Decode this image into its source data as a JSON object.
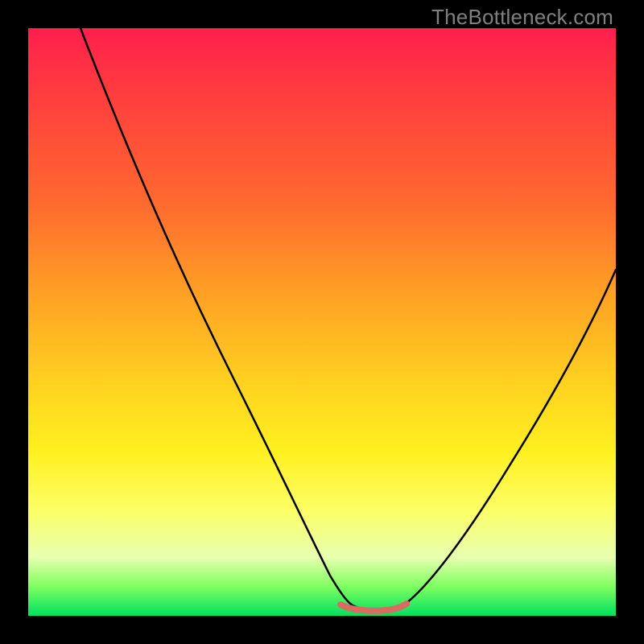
{
  "watermark": "TheBottleneck.com",
  "colors": {
    "page_bg": "#000000",
    "gradient_top": "#ff1f4d",
    "gradient_mid_high": "#ff6a2f",
    "gradient_mid": "#ffd020",
    "gradient_low": "#fcff66",
    "gradient_bottom": "#00e060",
    "curve": "#000000",
    "trough_highlight": "#d96b63",
    "watermark_text": "#808080"
  },
  "chart_data": {
    "type": "line",
    "title": "",
    "xlabel": "",
    "ylabel": "",
    "xlim": [
      0,
      100
    ],
    "ylim": [
      0,
      100
    ],
    "grid": false,
    "legend": "none",
    "note": "V-shaped bottleneck curve; rendered over a vertical rainbow gradient (red top → green bottom). The flat valley near the bottom is highlighted with a short salmon stroke.",
    "series": [
      {
        "name": "curve",
        "x": [
          9,
          15,
          22,
          30,
          38,
          45,
          50,
          53,
          55,
          58,
          61,
          63,
          67,
          74,
          82,
          90,
          100
        ],
        "y": [
          100,
          88,
          74,
          58,
          42,
          28,
          15,
          6,
          2,
          1,
          1,
          2,
          6,
          15,
          28,
          42,
          60
        ]
      }
    ],
    "trough": {
      "x_start": 53,
      "x_end": 63,
      "y": 1.5
    }
  }
}
